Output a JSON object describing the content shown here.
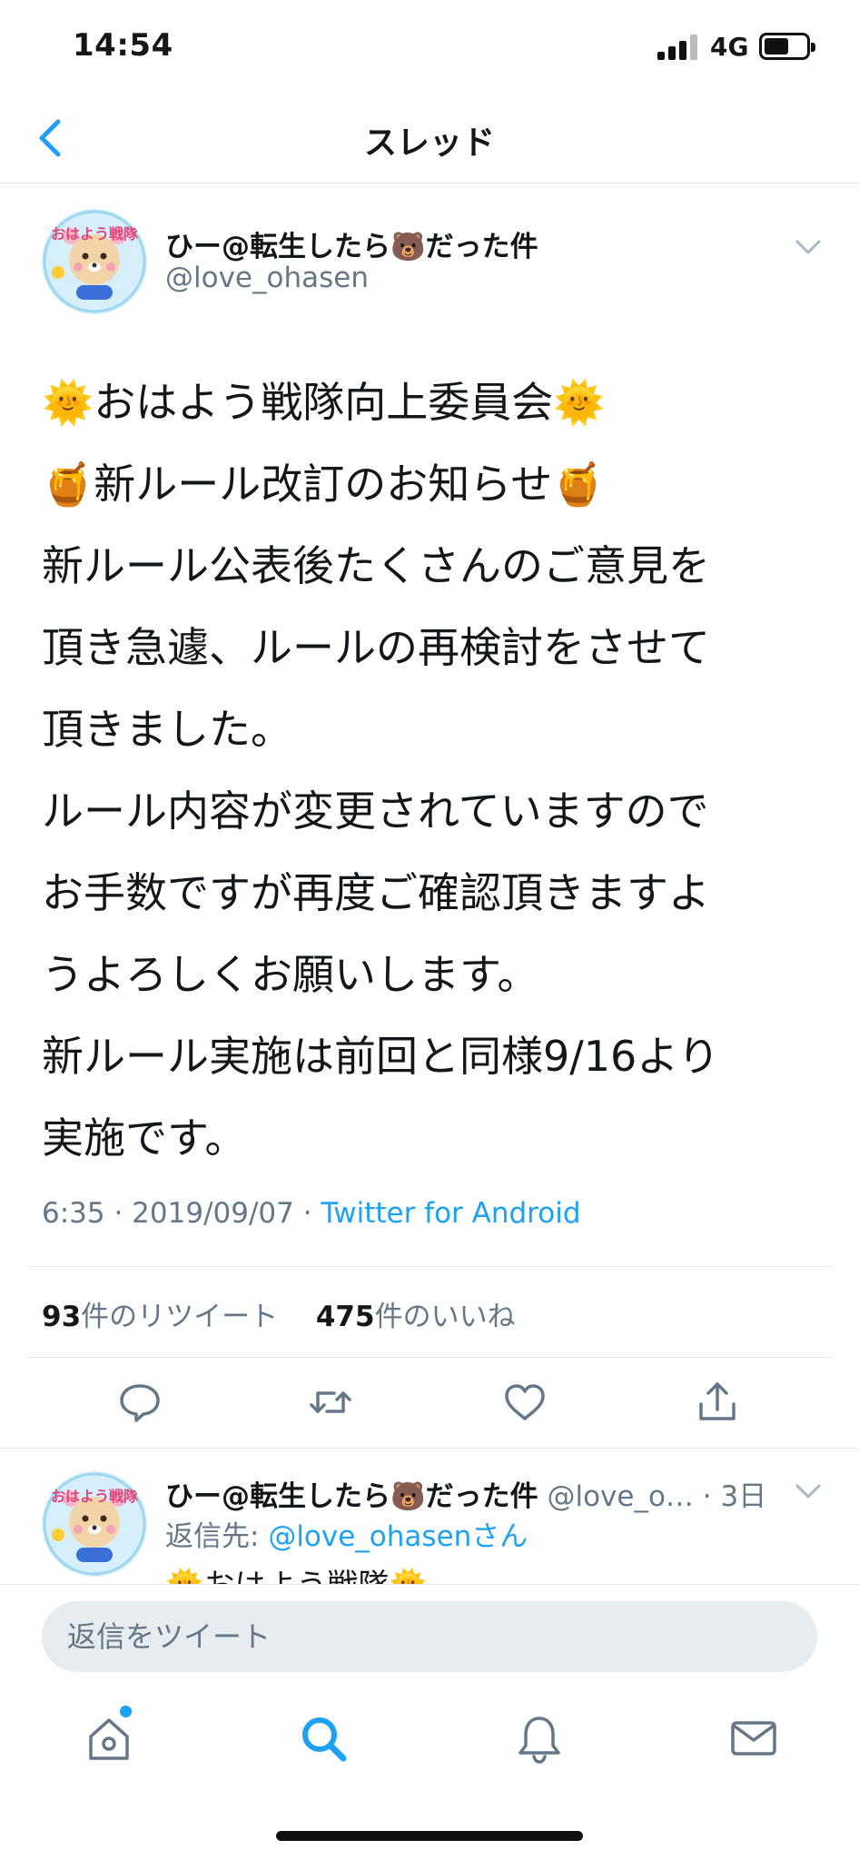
{
  "status_bar": {
    "time": "14:54",
    "network": "4G"
  },
  "header": {
    "title": "スレッド"
  },
  "tweet": {
    "author_name": "ひー@転生したら🐻だった件",
    "handle": "@love_ohasen",
    "avatar_text": "おはよう戦隊",
    "body_lines": [
      "🌞おはよう戦隊向上委員会🌞",
      "🍯新ルール改訂のお知らせ🍯",
      "新ルール公表後たくさんのご意見を",
      "頂き急遽、ルールの再検討をさせて",
      "頂きました。",
      "ルール内容が変更されていますので",
      "お手数ですが再度ご確認頂きますよ",
      "うよろしくお願いします。",
      "新ルール実施は前回と同様9/16より",
      "実施です。"
    ],
    "timestamp": "6:35 · 2019/09/07 · ",
    "source": "Twitter for Android",
    "retweet_count": "93",
    "retweet_label": "件のリツイート",
    "like_count": "475",
    "like_label": "件のいいね"
  },
  "reply": {
    "author_name": "ひー@転生したら🐻だった件",
    "handle_time": " @love_o… · 3日",
    "reply_to_prefix": "返信先: ",
    "reply_to_handle": "@love_ohasenさん",
    "snippet": "🌞おはよう戦隊🌞"
  },
  "compose": {
    "placeholder": "返信をツイート"
  },
  "icons": {
    "back": "chevron-left-icon",
    "caret": "chevron-down-icon",
    "reply": "comment-icon",
    "retweet": "retweet-icon",
    "like": "heart-icon",
    "share": "share-icon",
    "home": "home-icon",
    "search": "search-icon",
    "notifications": "bell-icon",
    "messages": "mail-icon"
  },
  "colors": {
    "accent": "#1da1f2",
    "secondary_text": "#657786",
    "divider": "#e1e8ed"
  }
}
